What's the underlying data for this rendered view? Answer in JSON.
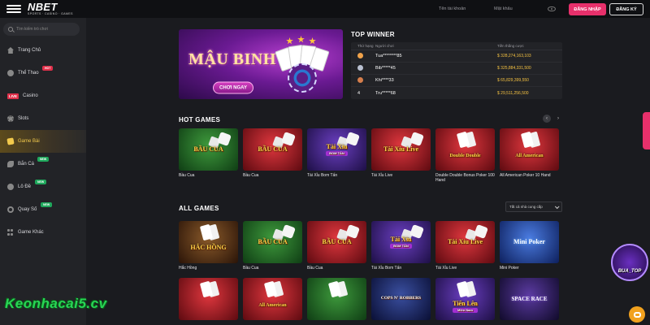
{
  "header": {
    "logo": "NBET",
    "logo_sub": "SPORTS · CASINO · GAMES",
    "username_placeholder": "Tên tài khoản",
    "password_placeholder": "Mật khẩu",
    "login_label": "ĐĂNG NHẬP",
    "register_label": "ĐĂNG KÝ"
  },
  "sidebar": {
    "search_placeholder": "Tìm kiếm trò chơi",
    "items": [
      {
        "label": "Trang Chủ",
        "icon": "home-icon"
      },
      {
        "label": "Thể Thao",
        "icon": "ball-icon",
        "badge": "HOT"
      },
      {
        "label": "Casino",
        "icon": "live-icon",
        "tag": "LIVE"
      },
      {
        "label": "Slots",
        "icon": "chip-icon"
      },
      {
        "label": "Game Bài",
        "icon": "cards-icon",
        "active": true
      },
      {
        "label": "Bắn Cá",
        "icon": "fish-icon",
        "badge": "NEW"
      },
      {
        "label": "Lô Đề",
        "icon": "lotto-icon",
        "badge": "NEW"
      },
      {
        "label": "Quay Số",
        "icon": "wheel-icon",
        "badge": "NEW"
      },
      {
        "label": "Game Khác",
        "icon": "grid-icon"
      }
    ]
  },
  "banner": {
    "title": "MẬU BINH",
    "cta": "CHƠI NGAY"
  },
  "top_winner": {
    "title": "TOP WINNER",
    "columns": [
      "Thứ hạng",
      "Người chơi",
      "Tiền thắng cược"
    ],
    "rows": [
      {
        "rank": "1",
        "player": "Tua********85",
        "amount": "328,274,163,103"
      },
      {
        "rank": "2",
        "player": "Bib*****45",
        "amount": "325,884,331,500"
      },
      {
        "rank": "3",
        "player": "Khi****33",
        "amount": "65,829,399,550"
      },
      {
        "rank": "4",
        "player": "Tru*****68",
        "amount": "29,511,256,500"
      }
    ]
  },
  "hot_games": {
    "title": "HOT GAMES",
    "items": [
      {
        "label": "Bầu Cua",
        "thumb": "BẦU CUA",
        "bg": "green"
      },
      {
        "label": "Bầu Cua",
        "thumb": "BẦU CUA",
        "bg": "red"
      },
      {
        "label": "Tài Xỉu Bom Tấn",
        "thumb": "Tài Xỉu",
        "sub": "BOM TẤN",
        "bg": "purple"
      },
      {
        "label": "Tài Xỉu Live",
        "thumb": "Tài Xỉu Live",
        "bg": "red"
      },
      {
        "label": "Double Double Bonus Poker 100 Hand",
        "thumb": "Double Double",
        "bg": "red"
      },
      {
        "label": "All American Poker 10 Hand",
        "thumb": "All American",
        "bg": "red"
      }
    ]
  },
  "all_games": {
    "title": "ALL GAMES",
    "sort_label": "Tất cả nhà cung cấp",
    "items": [
      {
        "label": "Hắc Hồng",
        "thumb": "HẮC HỒNG",
        "bg": "brown"
      },
      {
        "label": "Bầu Cua",
        "thumb": "BẦU CUA",
        "bg": "green"
      },
      {
        "label": "Bầu Cua",
        "thumb": "BẦU CUA",
        "bg": "red"
      },
      {
        "label": "Tài Xỉu Bom Tấn",
        "thumb": "Tài Xỉu",
        "sub": "BOM TẤN",
        "bg": "purple"
      },
      {
        "label": "Tài Xỉu Live",
        "thumb": "Tài Xỉu Live",
        "bg": "red"
      },
      {
        "label": "Mini Poker",
        "thumb": "Mini Poker",
        "bg": "blue"
      }
    ],
    "items_row2": [
      {
        "label": "",
        "thumb": "",
        "bg": "red"
      },
      {
        "label": "",
        "thumb": "All American",
        "bg": "red"
      },
      {
        "label": "",
        "thumb": "",
        "bg": "green"
      },
      {
        "label": "",
        "thumb": "COPS N' ROBBERS",
        "bg": "navy"
      },
      {
        "label": "",
        "thumb": "Tiến Lên",
        "sub": "Miền Nam",
        "bg": "purple"
      },
      {
        "label": "",
        "thumb": "SPACE RACE",
        "bg": "space"
      }
    ]
  },
  "promo_badge": "BUA_TOP",
  "watermark": "Keonhacai5.cv"
}
